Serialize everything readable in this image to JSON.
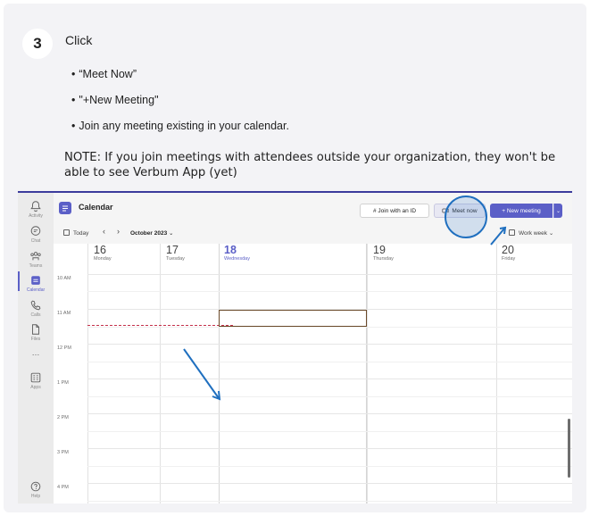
{
  "step": {
    "number": "3",
    "title": "Click",
    "bullets": [
      "“Meet Now”",
      "\"+New Meeting\"",
      "Join any meeting existing in your calendar."
    ],
    "note": "NOTE: If you join meetings with attendees outside your organization, they won't be able to see Verbum App (yet)"
  },
  "teams": {
    "rail": [
      {
        "label": "Activity",
        "icon": "bell-icon"
      },
      {
        "label": "Chat",
        "icon": "chat-icon"
      },
      {
        "label": "Teams",
        "icon": "teams-icon"
      },
      {
        "label": "Calendar",
        "icon": "calendar-icon"
      },
      {
        "label": "Calls",
        "icon": "phone-icon"
      },
      {
        "label": "Files",
        "icon": "file-icon"
      },
      {
        "label": "…",
        "icon": "more-icon"
      },
      {
        "label": "Apps",
        "icon": "apps-icon"
      },
      {
        "label": "Help",
        "icon": "help-icon"
      }
    ],
    "title": "Calendar",
    "join_label": "#  Join with an ID",
    "meet_now_label": "Meet now",
    "new_meeting_label": "+  New meeting",
    "today_label": "Today",
    "month_label": "October 2023",
    "view_label": "Work week",
    "days": [
      {
        "num": "16",
        "day": "Monday"
      },
      {
        "num": "17",
        "day": "Tuesday"
      },
      {
        "num": "18",
        "day": "Wednesday"
      },
      {
        "num": "19",
        "day": "Thursday"
      },
      {
        "num": "20",
        "day": "Friday"
      }
    ],
    "times": [
      "10 AM",
      "11 AM",
      "12 PM",
      "1 PM",
      "2 PM",
      "3 PM",
      "4 PM"
    ],
    "colors": {
      "accent": "#5b5fc7",
      "annotation": "#1f6fbf",
      "now_line": "#c4314b"
    }
  }
}
